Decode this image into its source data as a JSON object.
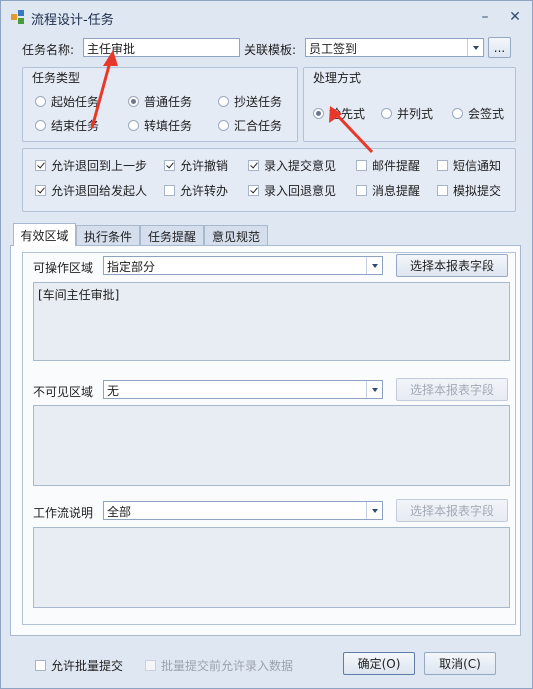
{
  "window": {
    "title": "流程设计-任务",
    "minimize_glyph": "–",
    "close_glyph": "✕"
  },
  "header": {
    "task_name_label": "任务名称:",
    "task_name_value": "主任审批",
    "template_label": "关联模板:",
    "template_value": "员工签到",
    "browse_label": "..."
  },
  "task_type": {
    "title": "任务类型",
    "options": [
      {
        "label": "起始任务",
        "checked": false
      },
      {
        "label": "普通任务",
        "checked": true
      },
      {
        "label": "抄送任务",
        "checked": false
      },
      {
        "label": "结束任务",
        "checked": false
      },
      {
        "label": "转填任务",
        "checked": false
      },
      {
        "label": "汇合任务",
        "checked": false
      }
    ]
  },
  "process_mode": {
    "title": "处理方式",
    "options": [
      {
        "label": "抢先式",
        "checked": true
      },
      {
        "label": "并列式",
        "checked": false
      },
      {
        "label": "会签式",
        "checked": false
      }
    ]
  },
  "options": [
    {
      "label": "允许退回到上一步",
      "checked": true
    },
    {
      "label": "允许撤销",
      "checked": true
    },
    {
      "label": "录入提交意见",
      "checked": true
    },
    {
      "label": "邮件提醒",
      "checked": false
    },
    {
      "label": "短信通知",
      "checked": false
    },
    {
      "label": "允许退回给发起人",
      "checked": true
    },
    {
      "label": "允许转办",
      "checked": false
    },
    {
      "label": "录入回退意见",
      "checked": true
    },
    {
      "label": "消息提醒",
      "checked": false
    },
    {
      "label": "模拟提交",
      "checked": false
    }
  ],
  "tabs": [
    "有效区域",
    "执行条件",
    "任务提醒",
    "意见规范"
  ],
  "active_tab": "有效区域",
  "sections": {
    "operable": {
      "label": "可操作区域",
      "value": "指定部分",
      "button": "选择本报表字段",
      "content": "[车间主任审批]"
    },
    "invisible": {
      "label": "不可见区域",
      "value": "无",
      "button": "选择本报表字段",
      "content": ""
    },
    "workflow": {
      "label": "工作流说明",
      "value": "全部",
      "button": "选择本报表字段",
      "content": ""
    }
  },
  "footer": {
    "batch_submit": "允许批量提交",
    "batch_input": "批量提交前允许录入数据",
    "ok": "确定(O)",
    "cancel": "取消(C)"
  },
  "colors": {
    "annotation_arrow": "#e8382a",
    "window_bg": "#dee6f1"
  }
}
